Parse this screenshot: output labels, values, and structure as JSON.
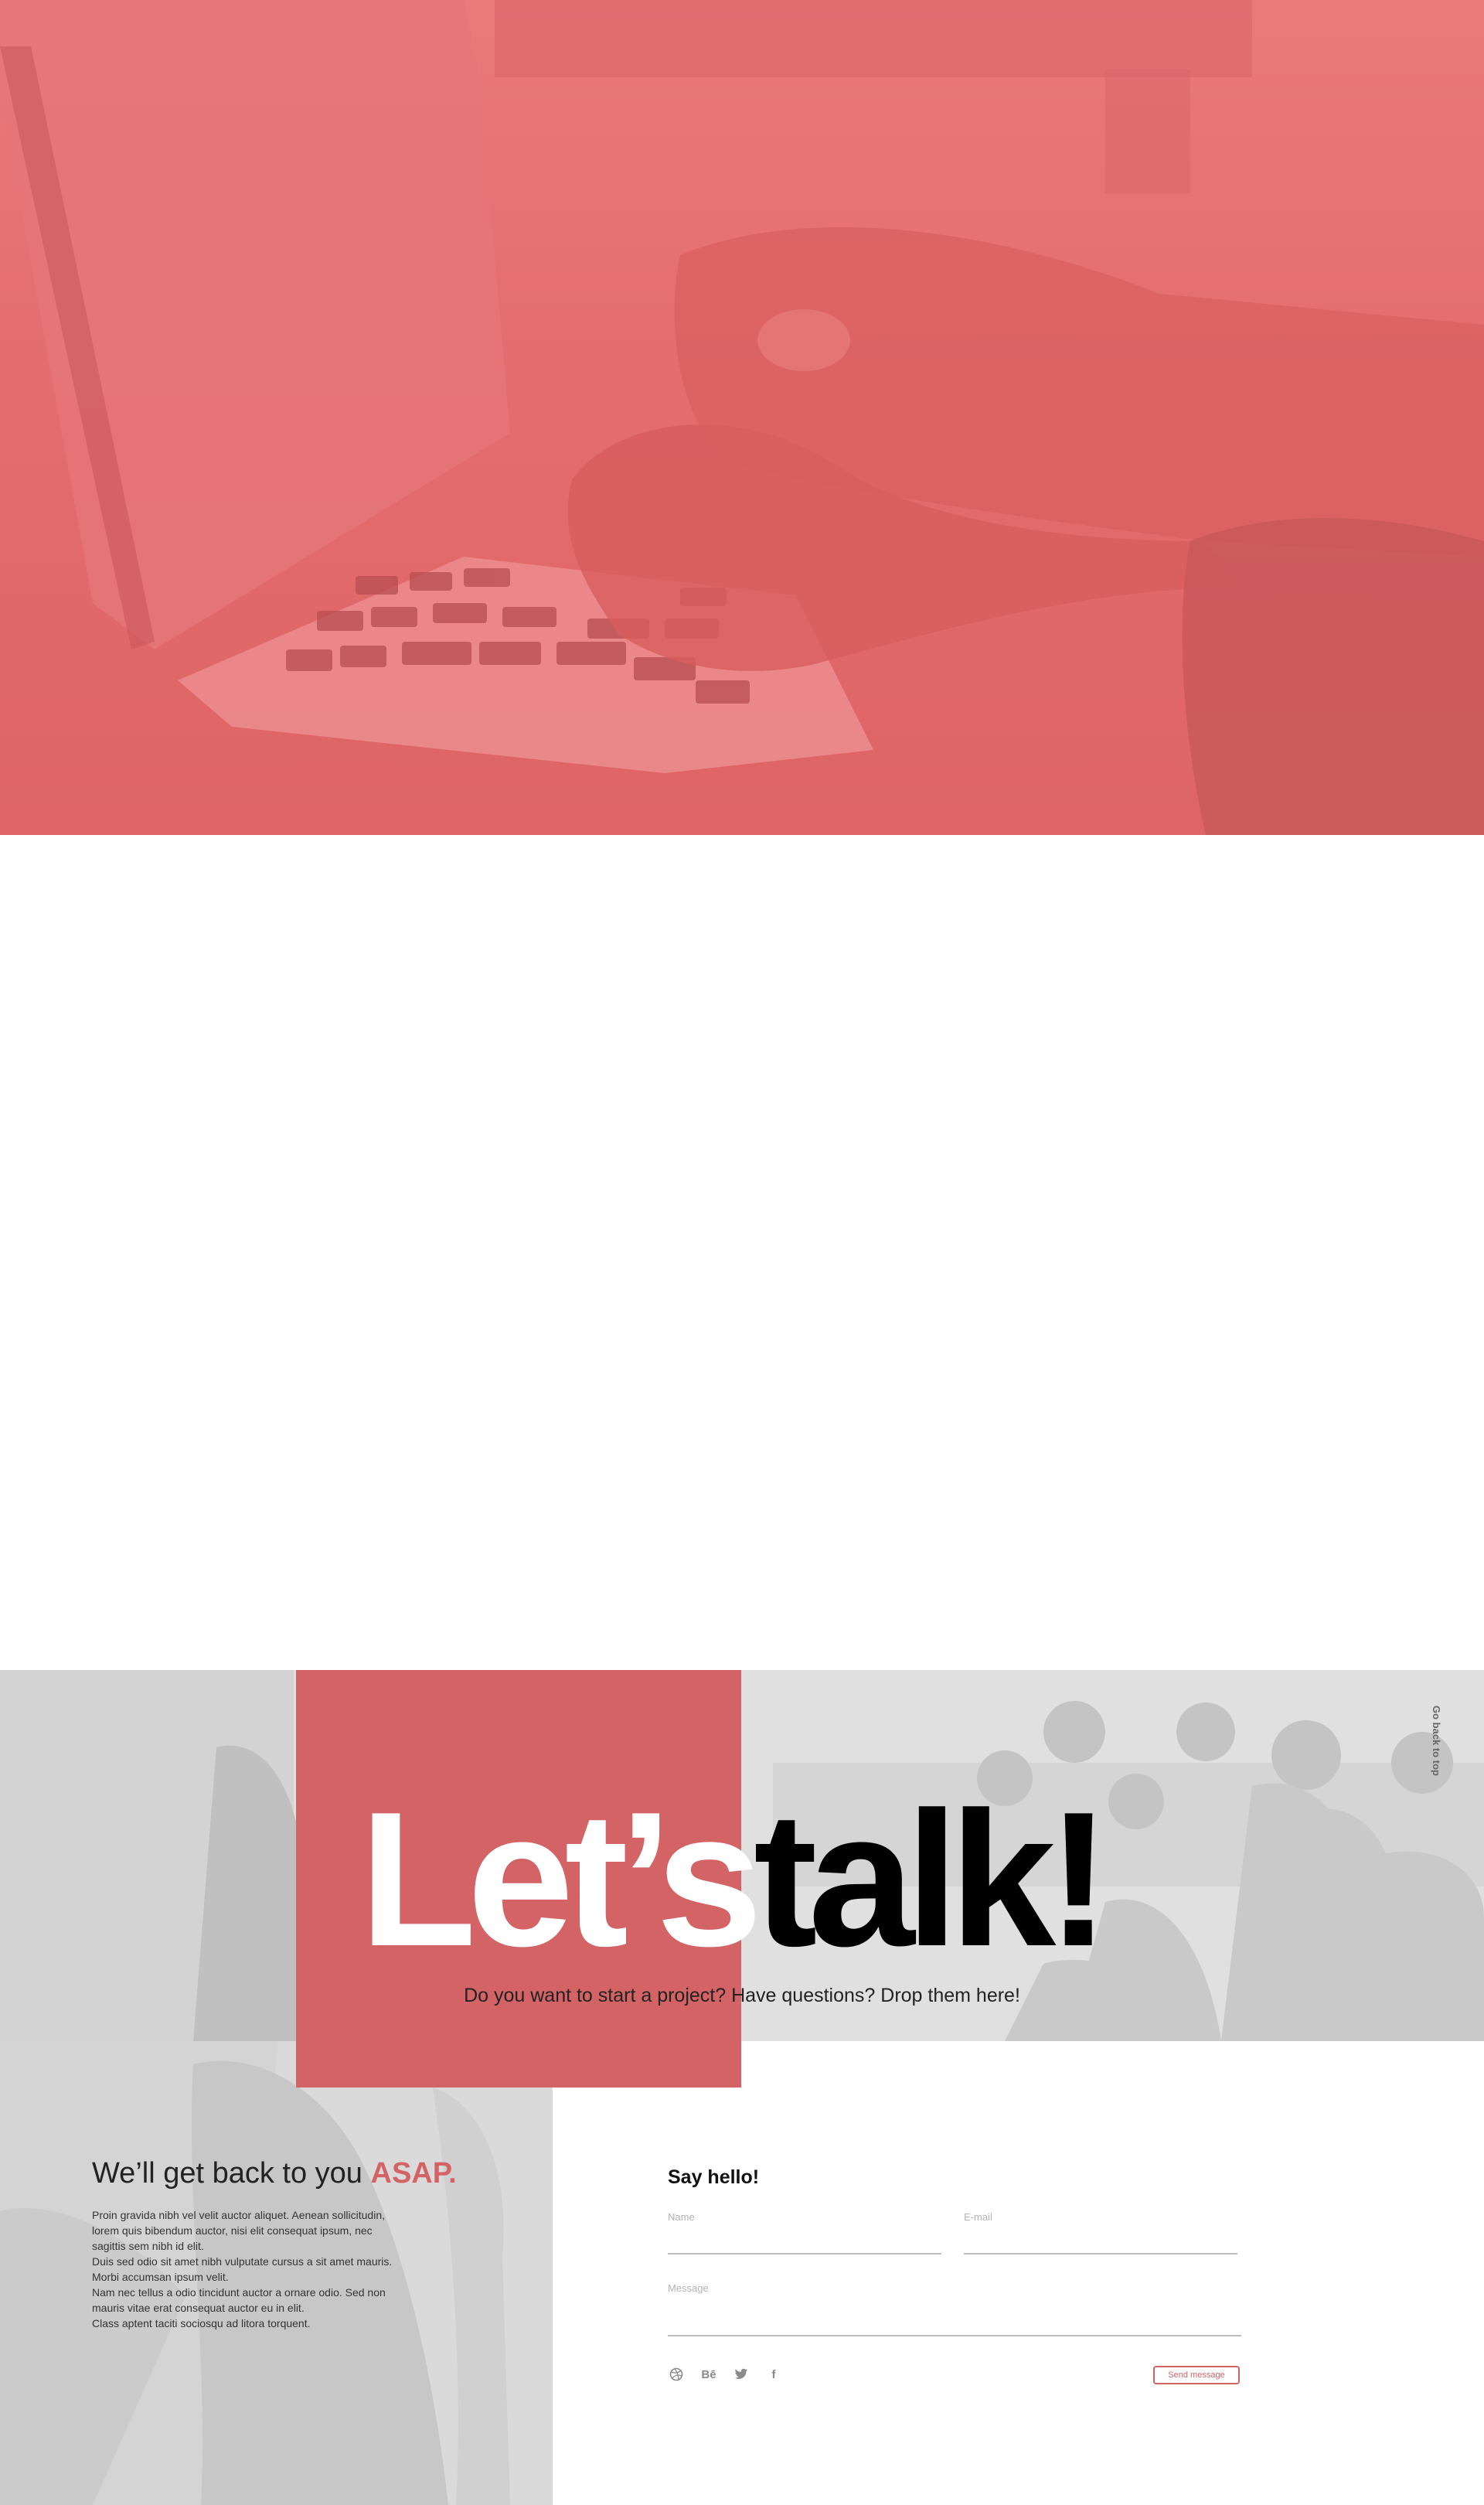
{
  "hero": {
    "image": "hands-typing-on-laptop",
    "overlay_color": "#e46d6e"
  },
  "contact": {
    "headline_part1": "Let’s",
    "headline_part2": "talk!",
    "subline": "Do you want to start a project? Have questions? Drop them here!",
    "back_to_top": "Go back to top",
    "accent_color": "#d46366"
  },
  "intro": {
    "title": "We’ll get back to you",
    "title_accent": "ASAP.",
    "lines": [
      "Proin gravida nibh vel velit auctor aliquet. Aenean sollicitudin,",
      "lorem quis bibendum auctor, nisi elit consequat ipsum, nec",
      "sagittis sem nibh id elit.",
      "Duis sed odio sit amet nibh vulputate cursus a sit amet mauris.",
      "Morbi accumsan ipsum velit.",
      "Nam nec tellus a odio tincidunt auctor a ornare odio. Sed non",
      "mauris vitae erat consequat auctor eu in elit.",
      "Class aptent taciti sociosqu ad litora torquent."
    ]
  },
  "form": {
    "title": "Say hello!",
    "name_label": "Name",
    "email_label": "E-mail",
    "message_label": "Message",
    "send_label": "Send message"
  },
  "socials": {
    "dribbble": "dribbble-icon",
    "behance": "Bē",
    "twitter": "twitter-icon",
    "facebook": "f"
  }
}
